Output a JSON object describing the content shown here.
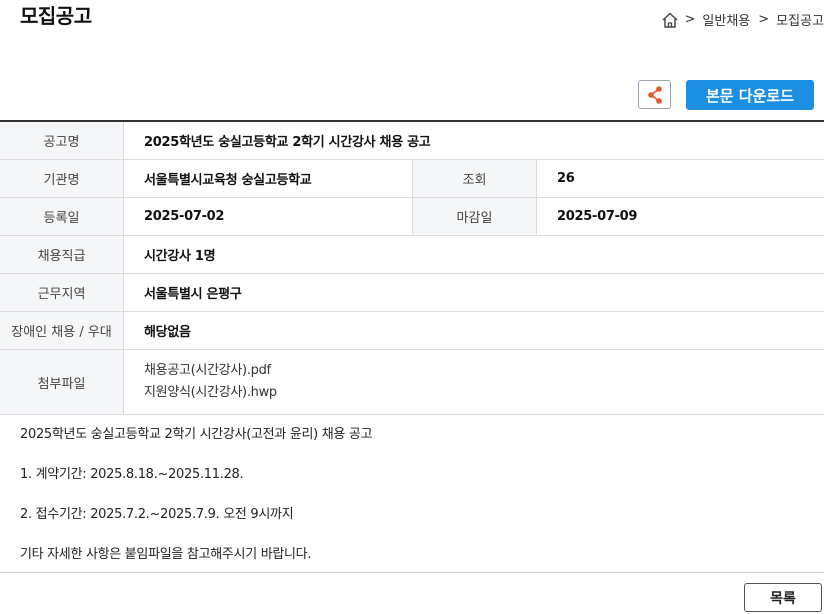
{
  "header": {
    "title": "모집공고",
    "breadcrumb": [
      ">",
      "일반채용",
      ">",
      "모집공고"
    ]
  },
  "actions": {
    "share_icon": "share-icon",
    "download_label": "본문 다운로드",
    "accent_color": "#1a8fe3",
    "share_icon_color": "#e8552b"
  },
  "info": {
    "title_label": "공고명",
    "title_value": "2025학년도 숭실고등학교 2학기 시간강사 채용 공고",
    "org_label": "기관명",
    "org_value": "서울특별시교육청 숭실고등학교",
    "views_label": "조회",
    "views_value": "26",
    "reg_label": "등록일",
    "reg_value": "2025-07-02",
    "deadline_label": "마감일",
    "deadline_value": "2025-07-09",
    "position_label": "채용직급",
    "position_value": "시간강사 1명",
    "region_label": "근무지역",
    "region_value": "서울특별시 은평구",
    "disability_label": "장애인 채용 / 우대",
    "disability_value": "해당없음",
    "files_label": "첨부파일",
    "files": [
      "채용공고(시간강사).pdf",
      "지원양식(시간강사).hwp"
    ]
  },
  "body": {
    "lines": [
      "2025학년도 숭실고등학교 2학기 시간강사(고전과 윤리) 채용 공고",
      "1. 계약기간: 2025.8.18.~2025.11.28.",
      "2. 접수기간: 2025.7.2.~2025.7.9. 오전 9시까지",
      "기타 자세한 사항은 붙임파일을 참고해주시기 바랍니다."
    ]
  },
  "footer": {
    "list_label": "목록"
  }
}
